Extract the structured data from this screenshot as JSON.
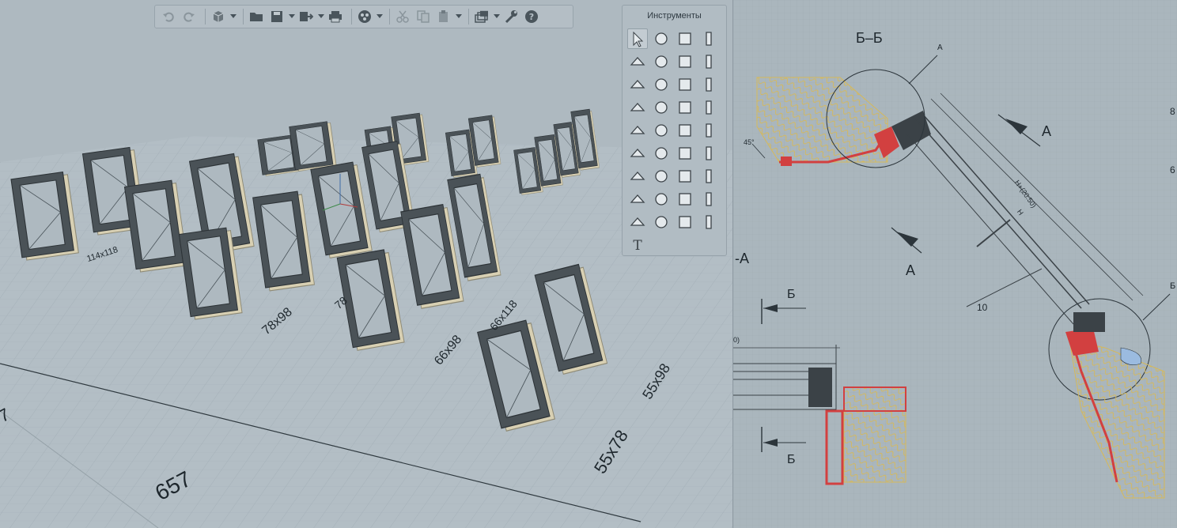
{
  "toolbar": {
    "buttons": [
      "undo-icon",
      "redo-icon",
      "view-cube-icon",
      "open-folder-icon",
      "save-icon",
      "export-icon",
      "print-icon",
      "render-icon",
      "cut-icon",
      "copy-icon",
      "paste-icon",
      "layers-icon",
      "settings-wrench-icon",
      "help-icon"
    ]
  },
  "tools_panel": {
    "title": "Инструменты",
    "tools": [
      "select-arrow-icon",
      "orbit-icon",
      "wall-icon",
      "column-icon",
      "slab-icon",
      "beam-icon",
      "roof-icon",
      "pencil-icon",
      "stair-icon",
      "ramp-icon",
      "door-icon",
      "window-icon",
      "railing-icon",
      "line-icon",
      "object-icon",
      "pipe-icon",
      "equipment-icon",
      "appliance-icon",
      "fitting-icon",
      "duct-icon",
      "sanitary-icon",
      "light-icon",
      "valve-icon",
      "outlet-icon",
      "group-icon",
      "cabinet-icon",
      "pump-icon",
      "vent-icon",
      "panel-icon",
      "cone-icon",
      "camera-icon",
      "lamp-icon",
      "zone-icon",
      "measure-icon",
      "connector-icon",
      "library-icon",
      "text-tool-icon"
    ]
  },
  "viewport3d": {
    "labels": {
      "w1": "114x118",
      "w2": "78x98",
      "w3": "78",
      "w4": "66x98",
      "w5": "66x118",
      "w6": "55x98",
      "w7": "55x78",
      "w8": "657",
      "w9": "7"
    }
  },
  "drawing2d": {
    "section_title": "Б–Б",
    "callout_a": "А",
    "callout_b": "Б",
    "view_a1": "А",
    "view_a2": "А",
    "section_a_left": "-А",
    "section_b_top": "Б",
    "section_b_bottom": "Б",
    "angle": "45°",
    "dim_h_plus": "H+(20:50)",
    "dim_h": "H",
    "dim_10": "10",
    "edge_label_1": "8",
    "edge_label_2": "6",
    "cut_label": "0)",
    "edge_label_3": "Б"
  },
  "colors": {
    "insulation": "#d6b95a",
    "seal_red": "#d24040",
    "frame_dark": "#3b4247",
    "frame_wood": "#d7cfb2"
  }
}
